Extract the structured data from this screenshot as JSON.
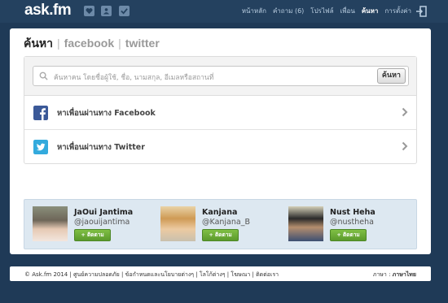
{
  "app": {
    "logo": "ask.fm"
  },
  "nav": {
    "items": [
      "หน้าหลัก",
      "คำถาม (6)",
      "โปรไฟล์",
      "เพื่อน",
      "ค้นหา",
      "การตั้งค่า"
    ],
    "active_index": 4
  },
  "tabs": {
    "search": "ค้นหา",
    "facebook": "facebook",
    "twitter": "twitter"
  },
  "search": {
    "placeholder": "ค้นหาคน โดยชื่อผู้ใช้, ชื่อ, นามสกุล, อีเมลหรือสถานที่",
    "button": "ค้นหา"
  },
  "find": {
    "facebook_label": "หาเพื่อนผ่านทาง Facebook",
    "twitter_label": "หาเพื่อนผ่านทาง Twitter"
  },
  "suggestions": [
    {
      "name": "JaOui Jantima",
      "handle": "@jaouijantima",
      "follow": "+ ติดตาม"
    },
    {
      "name": "Kanjana",
      "handle": "@Kanjana_B",
      "follow": "+ ติดตาม"
    },
    {
      "name": "Nust Heha",
      "handle": "@nustheha",
      "follow": "+ ติดตาม"
    }
  ],
  "footer": {
    "links": "© Ask.fm 2014 | ศูนย์ความปลอดภัย | ข้อกำหนดและนโยบายต่างๆ | โลโก้ต่างๆ | โฆษณา | ติดต่อเรา",
    "lang_label": "ภาษา :",
    "lang_value": "ภาษาไทย"
  },
  "colors": {
    "background": "#1f3a57",
    "topbar": "#24415f",
    "follow_button": "#6aaa34",
    "facebook": "#3b5998",
    "twitter": "#33aadd"
  },
  "icons": [
    "heart-icon",
    "user-icon",
    "check-icon",
    "logout-icon",
    "search-icon",
    "facebook-icon",
    "twitter-icon",
    "chevron-right-icon"
  ]
}
